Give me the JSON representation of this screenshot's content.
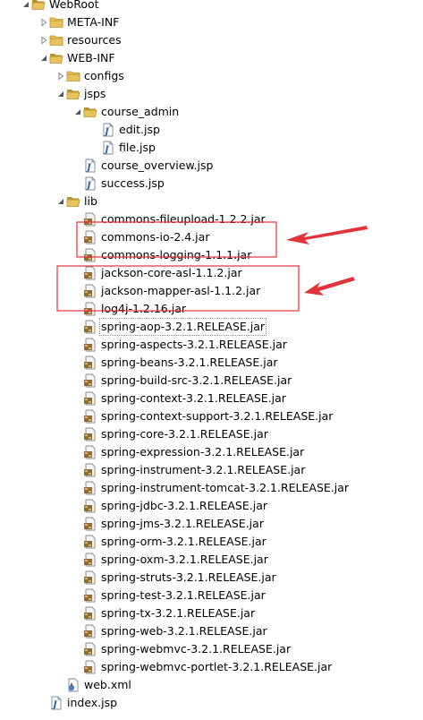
{
  "explorer": {
    "webroot": {
      "label": "WebRoot",
      "state": "expanded",
      "icon": "open-folder-icon"
    },
    "meta_inf": {
      "label": "META-INF",
      "state": "collapsed",
      "icon": "folder-icon"
    },
    "resources": {
      "label": "resources",
      "state": "collapsed",
      "icon": "folder-icon"
    },
    "web_inf": {
      "label": "WEB-INF",
      "state": "expanded",
      "icon": "open-folder-icon"
    },
    "configs": {
      "label": "configs",
      "state": "collapsed",
      "icon": "folder-icon"
    },
    "jsps": {
      "label": "jsps",
      "state": "expanded",
      "icon": "open-folder-icon"
    },
    "course_admin": {
      "label": "course_admin",
      "state": "expanded",
      "icon": "open-folder-icon"
    },
    "course_admin_files": [
      {
        "label": "edit.jsp",
        "icon": "jsp-file-icon"
      },
      {
        "label": "file.jsp",
        "icon": "jsp-file-icon"
      }
    ],
    "jsps_files": [
      {
        "label": "course_overview.jsp",
        "icon": "jsp-file-icon"
      },
      {
        "label": "success.jsp",
        "icon": "jsp-file-icon"
      }
    ],
    "lib": {
      "label": "lib",
      "state": "expanded",
      "icon": "open-folder-icon"
    },
    "lib_files": [
      {
        "label": "commons-fileupload-1.2.2.jar",
        "icon": "jar-file-icon"
      },
      {
        "label": "commons-io-2.4.jar",
        "icon": "jar-file-icon"
      },
      {
        "label": "commons-logging-1.1.1.jar",
        "icon": "jar-file-icon"
      },
      {
        "label": "jackson-core-asl-1.1.2.jar",
        "icon": "jar-file-icon"
      },
      {
        "label": "jackson-mapper-asl-1.1.2.jar",
        "icon": "jar-file-icon"
      },
      {
        "label": "log4j-1.2.16.jar",
        "icon": "jar-file-icon"
      },
      {
        "label": "spring-aop-3.2.1.RELEASE.jar",
        "icon": "jar-file-icon",
        "focused": true
      },
      {
        "label": "spring-aspects-3.2.1.RELEASE.jar",
        "icon": "jar-file-icon"
      },
      {
        "label": "spring-beans-3.2.1.RELEASE.jar",
        "icon": "jar-file-icon"
      },
      {
        "label": "spring-build-src-3.2.1.RELEASE.jar",
        "icon": "jar-file-icon"
      },
      {
        "label": "spring-context-3.2.1.RELEASE.jar",
        "icon": "jar-file-icon"
      },
      {
        "label": "spring-context-support-3.2.1.RELEASE.jar",
        "icon": "jar-file-icon"
      },
      {
        "label": "spring-core-3.2.1.RELEASE.jar",
        "icon": "jar-file-icon"
      },
      {
        "label": "spring-expression-3.2.1.RELEASE.jar",
        "icon": "jar-file-icon"
      },
      {
        "label": "spring-instrument-3.2.1.RELEASE.jar",
        "icon": "jar-file-icon"
      },
      {
        "label": "spring-instrument-tomcat-3.2.1.RELEASE.jar",
        "icon": "jar-file-icon"
      },
      {
        "label": "spring-jdbc-3.2.1.RELEASE.jar",
        "icon": "jar-file-icon"
      },
      {
        "label": "spring-jms-3.2.1.RELEASE.jar",
        "icon": "jar-file-icon"
      },
      {
        "label": "spring-orm-3.2.1.RELEASE.jar",
        "icon": "jar-file-icon"
      },
      {
        "label": "spring-oxm-3.2.1.RELEASE.jar",
        "icon": "jar-file-icon"
      },
      {
        "label": "spring-struts-3.2.1.RELEASE.jar",
        "icon": "jar-file-icon"
      },
      {
        "label": "spring-test-3.2.1.RELEASE.jar",
        "icon": "jar-file-icon"
      },
      {
        "label": "spring-tx-3.2.1.RELEASE.jar",
        "icon": "jar-file-icon"
      },
      {
        "label": "spring-web-3.2.1.RELEASE.jar",
        "icon": "jar-file-icon"
      },
      {
        "label": "spring-webmvc-3.2.1.RELEASE.jar",
        "icon": "jar-file-icon"
      },
      {
        "label": "spring-webmvc-portlet-3.2.1.RELEASE.jar",
        "icon": "jar-file-icon"
      }
    ],
    "web_xml": {
      "label": "web.xml",
      "icon": "xml-file-icon"
    },
    "index_jsp": {
      "label": "index.jsp",
      "icon": "jsp-file-icon"
    }
  },
  "annotations": {
    "color": "#e2323c",
    "callouts": [
      {
        "name": "highlight-box-commons",
        "covers": [
          "commons-fileupload-1.2.2.jar",
          "commons-io-2.4.jar"
        ]
      },
      {
        "name": "highlight-box-jackson",
        "covers": [
          "jackson-core-asl-1.1.2.jar",
          "jackson-mapper-asl-1.1.2.jar"
        ]
      }
    ]
  },
  "colors": {
    "folder": "#e8c25c",
    "folder_dark": "#b8902c",
    "jar": "#8f6b3a",
    "java_blue": "#2f5f9e",
    "focus_outline": "#7f9db9"
  }
}
